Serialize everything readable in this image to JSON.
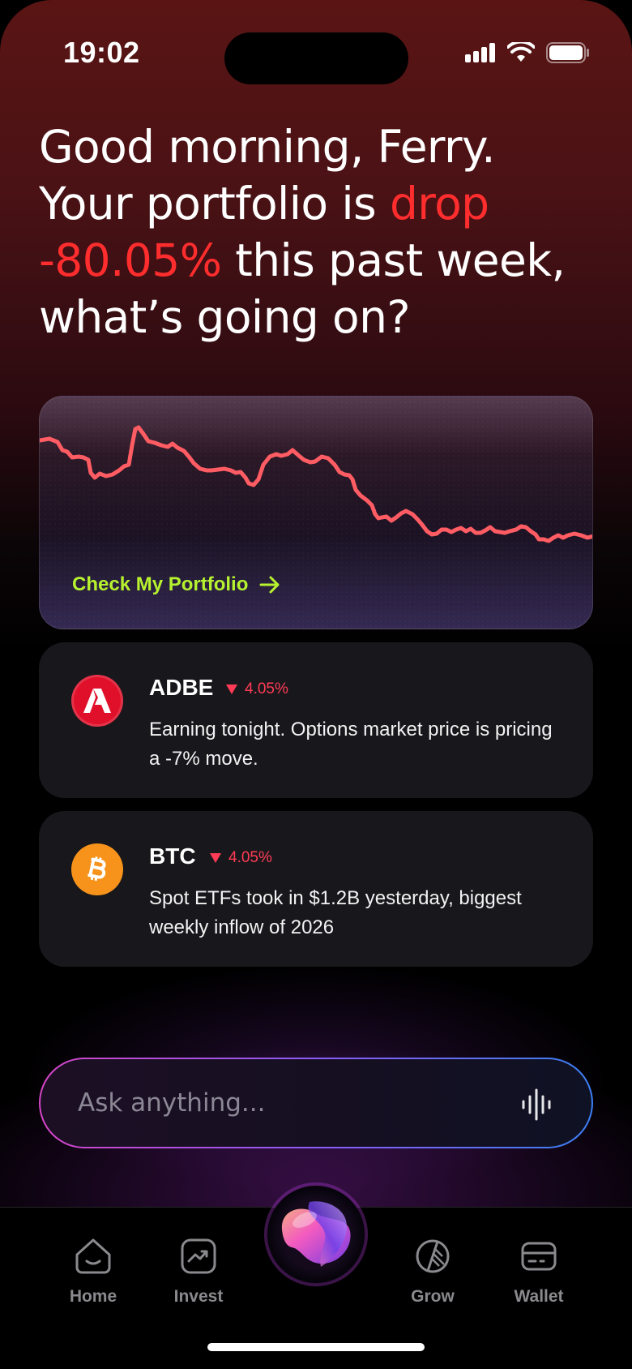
{
  "status_bar": {
    "time": "19:02"
  },
  "greeting": {
    "line1": "Good morning, Ferry.",
    "line2_a": "Your portfolio is ",
    "line2_b": "drop",
    "line3_a": "-80.05%",
    "line3_b": " this past week,",
    "line4": "what’s going on?"
  },
  "portfolio_card": {
    "link_label": "Check My Portfolio",
    "line_color": "#ff5c63"
  },
  "news": [
    {
      "ticker": "ADBE",
      "change": "4.05%",
      "direction": "down",
      "description": "Earning tonight. Options market price is pricing a -7% move.",
      "logo_icon": "adobe-icon",
      "logo_color": "#e0102a"
    },
    {
      "ticker": "BTC",
      "change": "4.05%",
      "direction": "down",
      "description": "Spot ETFs took in $1.2B yesterday, biggest weekly inflow of 2026",
      "logo_icon": "bitcoin-icon",
      "logo_color": "#f7931a"
    }
  ],
  "ask": {
    "placeholder": "Ask anything..."
  },
  "tabs": [
    {
      "label": "Home",
      "icon": "home-icon"
    },
    {
      "label": "Invest",
      "icon": "invest-icon"
    },
    {
      "label": "Grow",
      "icon": "grow-icon"
    },
    {
      "label": "Wallet",
      "icon": "wallet-icon"
    }
  ],
  "colors": {
    "accent_green": "#b7f22f",
    "loss_red": "#ff2d2d",
    "change_red": "#ff3b55"
  }
}
